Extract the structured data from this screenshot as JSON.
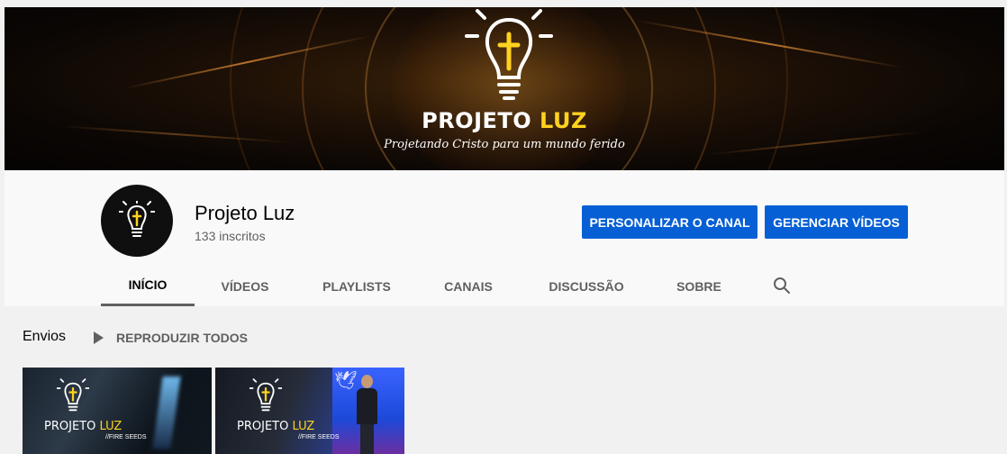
{
  "banner": {
    "title_main": "PROJETO ",
    "title_accent": "LUZ",
    "subtitle": "Projetando Cristo para um mundo ferido",
    "icon": "lightbulb-cross-icon"
  },
  "channel": {
    "name": "Projeto Luz",
    "subscribers": "133 inscritos",
    "avatar_icon": "lightbulb-cross-icon"
  },
  "buttons": {
    "customize": "PERSONALIZAR O CANAL",
    "manage": "GERENCIAR VÍDEOS"
  },
  "tabs": [
    {
      "label": "INÍCIO",
      "active": true
    },
    {
      "label": "VÍDEOS",
      "active": false
    },
    {
      "label": "PLAYLISTS",
      "active": false
    },
    {
      "label": "CANAIS",
      "active": false
    },
    {
      "label": "DISCUSSÃO",
      "active": false
    },
    {
      "label": "SOBRE",
      "active": false
    }
  ],
  "search_icon": "search-icon",
  "uploads": {
    "title": "Envios",
    "play_all": "REPRODUZIR TODOS",
    "videos": [
      {
        "brand_main": "PROJETO ",
        "brand_accent": "LUZ",
        "tag": "//FIRE SEEDS"
      },
      {
        "brand_main": "PROJETO ",
        "brand_accent": "LUZ",
        "tag": "//FIRE SEEDS"
      }
    ]
  },
  "colors": {
    "accent_blue": "#065fd4",
    "brand_yellow": "#ffd21f",
    "banner_bg": "#0a0604"
  }
}
